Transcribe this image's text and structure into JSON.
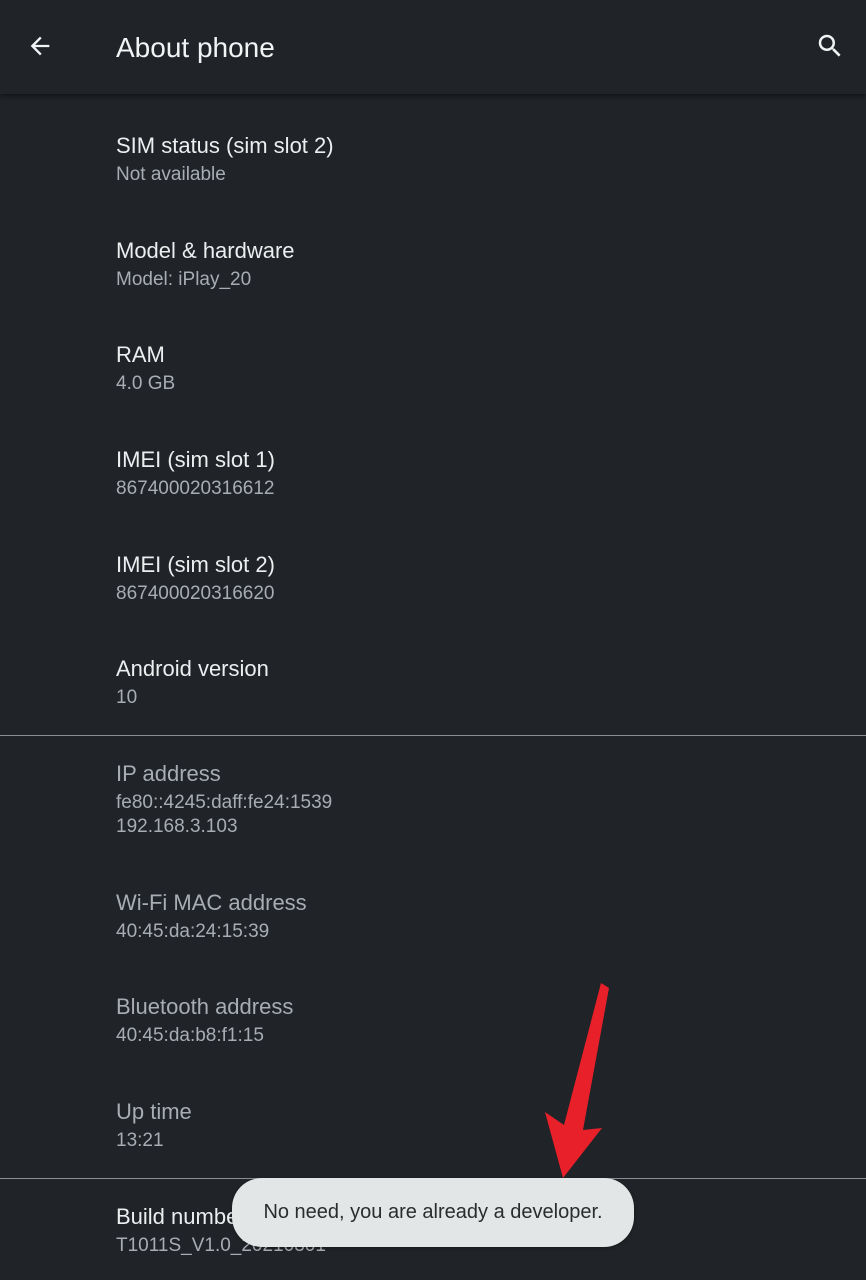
{
  "app_bar": {
    "title": "About phone",
    "back_icon": "back-arrow-icon",
    "search_icon": "search-icon"
  },
  "items": [
    {
      "label": "SIM status (sim slot 2)",
      "value": "Not available"
    },
    {
      "label": "Model & hardware",
      "value": "Model: iPlay_20"
    },
    {
      "label": "RAM",
      "value": "4.0 GB"
    },
    {
      "label": "IMEI (sim slot 1)",
      "value": "867400020316612"
    },
    {
      "label": "IMEI (sim slot 2)",
      "value": "867400020316620"
    },
    {
      "label": "Android version",
      "value": "10"
    }
  ],
  "network_items": [
    {
      "label": "IP address",
      "value_line1": "fe80::4245:daff:fe24:1539",
      "value_line2": "192.168.3.103"
    },
    {
      "label": "Wi-Fi MAC address",
      "value": "40:45:da:24:15:39"
    },
    {
      "label": "Bluetooth address",
      "value": "40:45:da:b8:f1:15"
    },
    {
      "label": "Up time",
      "value": "13:21"
    }
  ],
  "build": {
    "label": "Build number",
    "value": "T1011S_V1.0_20210301"
  },
  "toast": {
    "message": "No need, you are already a developer."
  },
  "colors": {
    "background": "#202327",
    "primary_text": "#eceef0",
    "secondary_text": "#a8adb3",
    "toast_bg": "#e3e6e7",
    "annotation_arrow": "#e8202a"
  }
}
